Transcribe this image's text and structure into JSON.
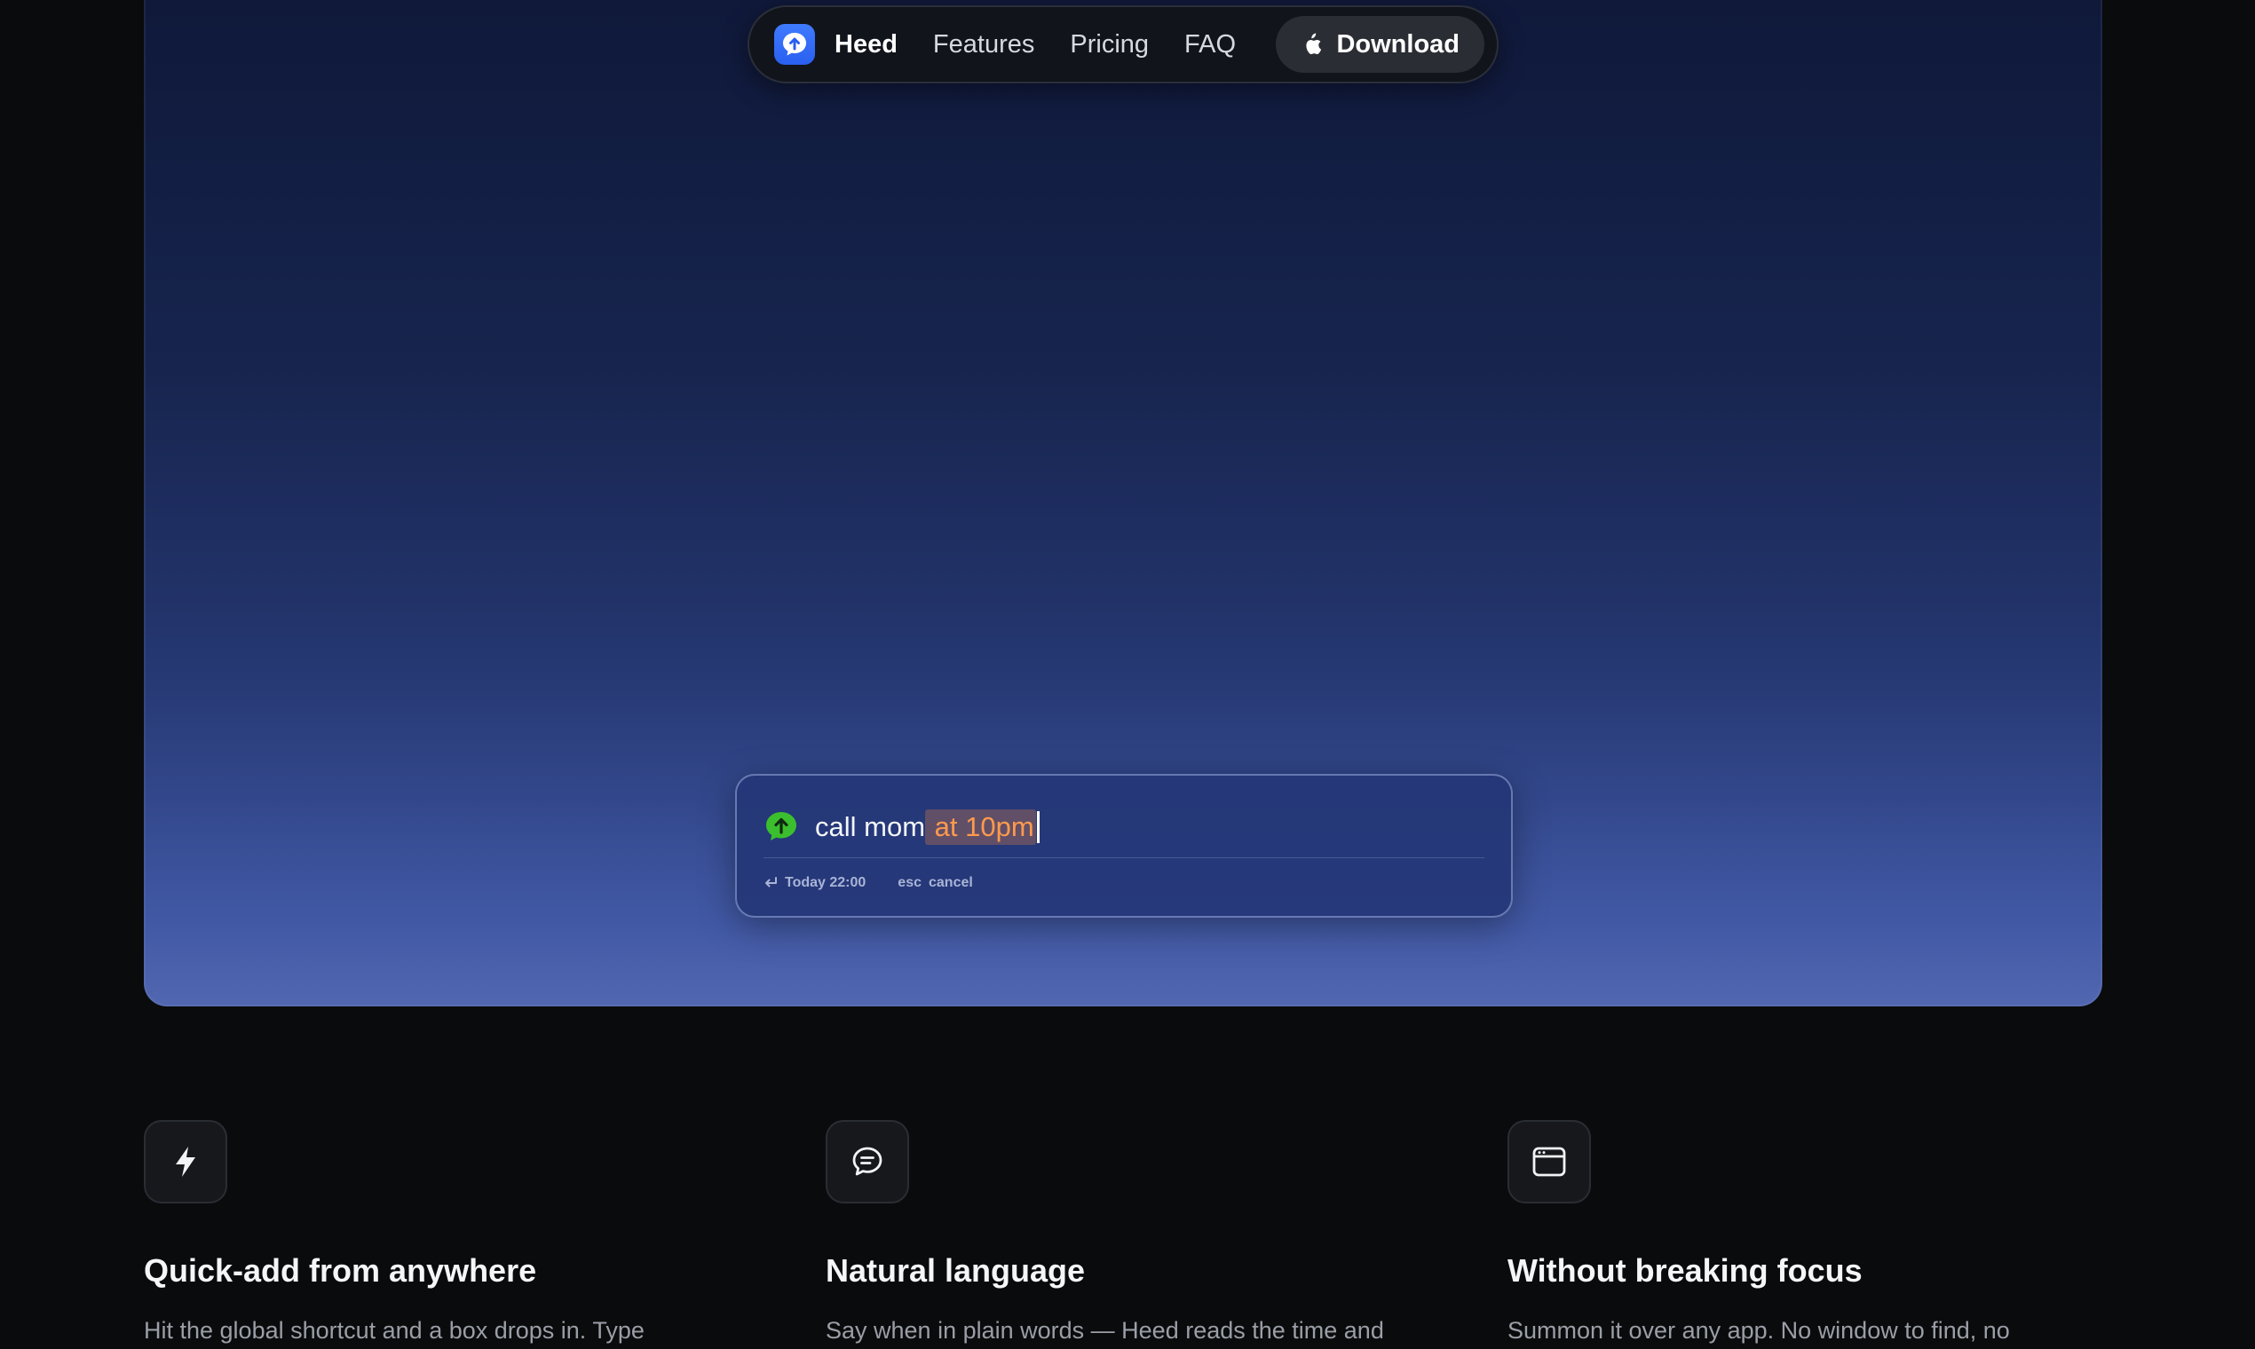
{
  "nav": {
    "brand": "Heed",
    "links": [
      "Features",
      "Pricing",
      "FAQ"
    ],
    "download_label": "Download",
    "logo_icon": "heed-logo-icon",
    "download_icon": "apple-icon",
    "accent": "#3f7bff"
  },
  "quickadd": {
    "text_plain": "call mom",
    "text_parsed": " at 10pm",
    "parsed_color": "#ff9a4d",
    "status_icon": "arrow-up-circle-icon",
    "status_color": "#3bbf2e",
    "hint_enter_icon": "return-icon",
    "hint_when": "Today 22:00",
    "hint_esc_key": "esc",
    "hint_cancel": "cancel"
  },
  "features": [
    {
      "icon": "lightning-icon",
      "title": "Quick-add from anywhere",
      "desc": "Hit the global shortcut and a box drops in. Type"
    },
    {
      "icon": "chat-bubble-icon",
      "title": "Natural language",
      "desc": "Say when in plain words — Heed reads the time and"
    },
    {
      "icon": "window-icon",
      "title": "Without breaking focus",
      "desc": "Summon it over any app. No window to find, no"
    }
  ]
}
